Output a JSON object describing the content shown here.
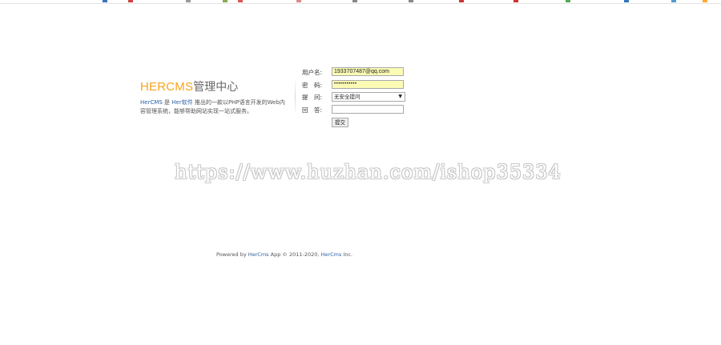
{
  "brand": {
    "title_latin": "HERCMS",
    "title_cjk": "管理中心",
    "desc_link1": "HerCMS",
    "desc_part1": " 是 ",
    "desc_link2": "Her软件",
    "desc_part2": " 推出的一款以PHP语言开发的Web内容管理系统，能够帮助网站实现一站式服务。"
  },
  "form": {
    "username_label": "用户名:",
    "username_value": "1933707487@qq.com",
    "password_label": "密　码:",
    "password_value": "•••••••••••",
    "question_label": "提　问:",
    "question_selected": "无安全提问",
    "answer_label": "回　答:",
    "answer_value": "",
    "submit_label": "提交"
  },
  "watermark": "https://www.huzhan.com/ishop35334",
  "footer": {
    "prefix": "Powered by ",
    "link1": "HerCms",
    "middle": " App © 2011-2020, ",
    "link2": "HerCms",
    "suffix": " Inc."
  },
  "colors": {
    "brand_orange": "#f7a51d",
    "link_blue": "#2d5fa6",
    "autofill_yellow": "#fbfbb5"
  }
}
